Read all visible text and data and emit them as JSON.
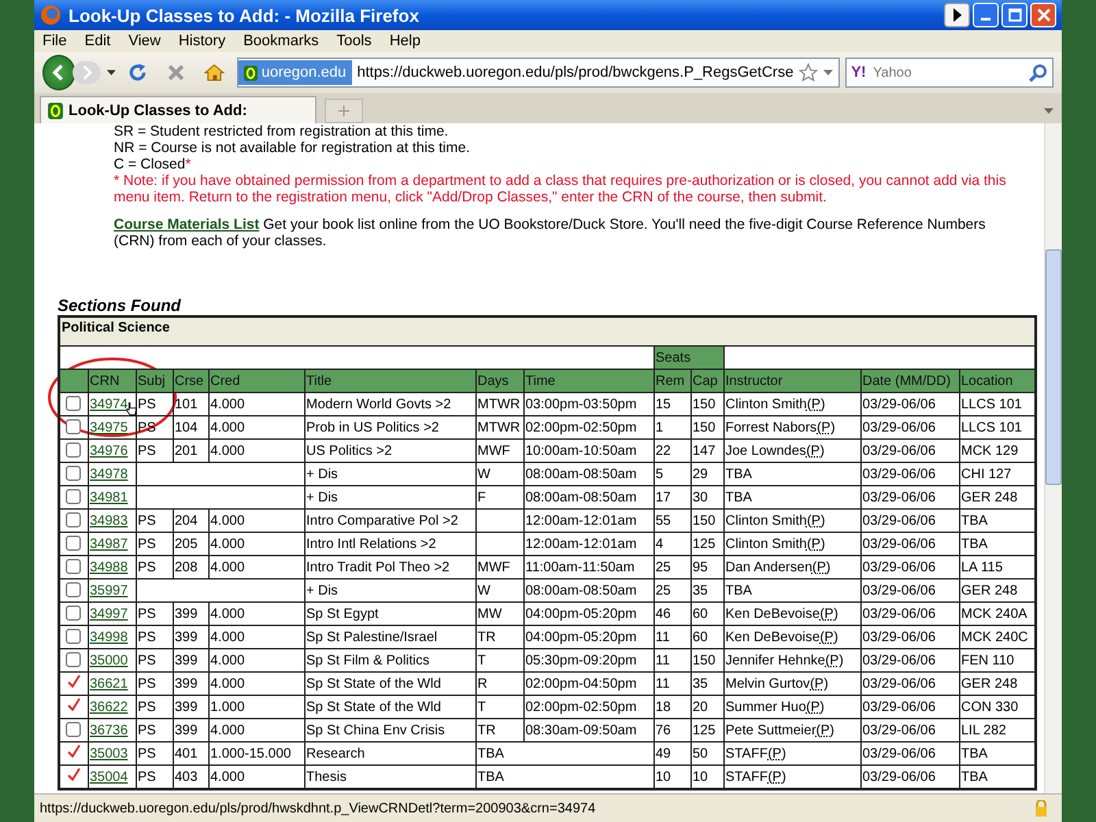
{
  "window": {
    "title": "Look-Up Classes to Add: - Mozilla Firefox"
  },
  "menu": [
    "File",
    "Edit",
    "View",
    "History",
    "Bookmarks",
    "Tools",
    "Help"
  ],
  "toolbar": {
    "site": "uoregon.edu",
    "url": "https://duckweb.uoregon.edu/pls/prod/bwckgens.P_RegsGetCrse",
    "engine_mark": "Y!",
    "search_placeholder": "Yahoo"
  },
  "tabs": [
    {
      "label": "Look-Up Classes to Add:",
      "selected": true
    }
  ],
  "legend": [
    {
      "text": "SR = Student restricted from registration at this time."
    },
    {
      "text": "NR = Course is not available for registration at this time."
    },
    {
      "text": "C = Closed",
      "marker": "*"
    }
  ],
  "note": "* Note: if you have obtained permission from a department to add a class that requires pre-authorization or is closed, you cannot add via this menu item. Return to the registration menu, click \"Add/Drop Classes,\" enter the CRN of the course, then submit.",
  "materials": {
    "link": "Course Materials List",
    "text": "Get your book list online from the UO Bookstore/Duck Store. You'll need the five-digit Course Reference Numbers (CRN) from each of your classes."
  },
  "sections": {
    "heading": "Sections Found",
    "subject": "Political Science",
    "group_header": "Seats",
    "columns": [
      "CRN",
      "Subj",
      "Crse",
      "Cred",
      "Title",
      "Days",
      "Time",
      "Rem",
      "Cap",
      "Instructor",
      "Date (MM/DD)",
      "Location"
    ],
    "rows": [
      {
        "registered": false,
        "crn": "34974",
        "subj": "PS",
        "crse": "101",
        "cred": "4.000",
        "title": "Modern World Govts >2",
        "days": "MTWR",
        "time": "03:00pm-03:50pm",
        "rem": "15",
        "cap": "150",
        "instructor": "Clinton Smith",
        "role": "(P)",
        "date": "03/29-06/06",
        "location": "LLCS 101"
      },
      {
        "registered": false,
        "crn": "34975",
        "subj": "PS",
        "crse": "104",
        "cred": "4.000",
        "title": "Prob in US Politics >2",
        "days": "MTWR",
        "time": "02:00pm-02:50pm",
        "rem": "1",
        "cap": "150",
        "instructor": "Forrest Nabors",
        "role": "(P)",
        "date": "03/29-06/06",
        "location": "LLCS 101"
      },
      {
        "registered": false,
        "crn": "34976",
        "subj": "PS",
        "crse": "201",
        "cred": "4.000",
        "title": "US Politics >2",
        "days": "MWF",
        "time": "10:00am-10:50am",
        "rem": "22",
        "cap": "147",
        "instructor": "Joe Lowndes",
        "role": "(P)",
        "date": "03/29-06/06",
        "location": "MCK 129"
      },
      {
        "registered": false,
        "crn": "34978",
        "title": "+ Dis",
        "days": "W",
        "time": "08:00am-08:50am",
        "rem": "5",
        "cap": "29",
        "instructor": "TBA",
        "date": "03/29-06/06",
        "location": "CHI 127"
      },
      {
        "registered": false,
        "crn": "34981",
        "title": "+ Dis",
        "days": "F",
        "time": "08:00am-08:50am",
        "rem": "17",
        "cap": "30",
        "instructor": "TBA",
        "date": "03/29-06/06",
        "location": "GER 248"
      },
      {
        "registered": false,
        "crn": "34983",
        "subj": "PS",
        "crse": "204",
        "cred": "4.000",
        "title": "Intro Comparative Pol >2",
        "time": "12:00am-12:01am",
        "rem": "55",
        "cap": "150",
        "instructor": "Clinton Smith",
        "role": "(P)",
        "date": "03/29-06/06",
        "location": "TBA"
      },
      {
        "registered": false,
        "crn": "34987",
        "subj": "PS",
        "crse": "205",
        "cred": "4.000",
        "title": "Intro Intl Relations >2",
        "time": "12:00am-12:01am",
        "rem": "4",
        "cap": "125",
        "instructor": "Clinton Smith",
        "role": "(P)",
        "date": "03/29-06/06",
        "location": "TBA"
      },
      {
        "registered": false,
        "crn": "34988",
        "subj": "PS",
        "crse": "208",
        "cred": "4.000",
        "title": "Intro Tradit Pol Theo >2",
        "days": "MWF",
        "time": "11:00am-11:50am",
        "rem": "25",
        "cap": "95",
        "instructor": "Dan Andersen",
        "role": "(P)",
        "date": "03/29-06/06",
        "location": "LA 115"
      },
      {
        "registered": false,
        "crn": "35997",
        "title": "+ Dis",
        "days": "W",
        "time": "08:00am-08:50am",
        "rem": "25",
        "cap": "35",
        "instructor": "TBA",
        "date": "03/29-06/06",
        "location": "GER 248"
      },
      {
        "registered": false,
        "crn": "34997",
        "subj": "PS",
        "crse": "399",
        "cred": "4.000",
        "title": "Sp St Egypt",
        "days": "MW",
        "time": "04:00pm-05:20pm",
        "rem": "46",
        "cap": "60",
        "instructor": "Ken DeBevoise",
        "role": "(P)",
        "date": "03/29-06/06",
        "location": "MCK 240A"
      },
      {
        "registered": false,
        "crn": "34998",
        "subj": "PS",
        "crse": "399",
        "cred": "4.000",
        "title": "Sp St Palestine/Israel",
        "days": "TR",
        "time": "04:00pm-05:20pm",
        "rem": "11",
        "cap": "60",
        "instructor": "Ken DeBevoise",
        "role": "(P)",
        "date": "03/29-06/06",
        "location": "MCK 240C"
      },
      {
        "registered": false,
        "crn": "35000",
        "subj": "PS",
        "crse": "399",
        "cred": "4.000",
        "title": "Sp St Film & Politics",
        "days": "T",
        "time": "05:30pm-09:20pm",
        "rem": "11",
        "cap": "150",
        "instructor": "Jennifer Hehnke",
        "role": "(P)",
        "date": "03/29-06/06",
        "location": "FEN 110"
      },
      {
        "registered": true,
        "crn": "36621",
        "subj": "PS",
        "crse": "399",
        "cred": "4.000",
        "title": "Sp St State of the Wld",
        "days": "R",
        "time": "02:00pm-04:50pm",
        "rem": "11",
        "cap": "35",
        "instructor": "Melvin Gurtov",
        "role": "(P)",
        "date": "03/29-06/06",
        "location": "GER 248"
      },
      {
        "registered": true,
        "crn": "36622",
        "subj": "PS",
        "crse": "399",
        "cred": "1.000",
        "title": "Sp St State of the Wld",
        "days": "T",
        "time": "02:00pm-02:50pm",
        "rem": "18",
        "cap": "20",
        "instructor": "Summer Huo",
        "role": "(P)",
        "date": "03/29-06/06",
        "location": "CON 330"
      },
      {
        "registered": false,
        "crn": "36736",
        "subj": "PS",
        "crse": "399",
        "cred": "4.000",
        "title": "Sp St China Env Crisis",
        "days": "TR",
        "time": "08:30am-09:50am",
        "rem": "76",
        "cap": "125",
        "instructor": "Pete Suttmeier",
        "role": "(P)",
        "date": "03/29-06/06",
        "location": "LIL 282"
      },
      {
        "registered": true,
        "crn": "35003",
        "subj": "PS",
        "crse": "401",
        "cred": "1.000-15.000",
        "title": "Research",
        "days": "TBA",
        "rem": "49",
        "cap": "50",
        "instructor": "STAFF",
        "role": "(P)",
        "date": "03/29-06/06",
        "location": "TBA"
      },
      {
        "registered": true,
        "crn": "35004",
        "subj": "PS",
        "crse": "403",
        "cred": "4.000",
        "title": "Thesis",
        "days": "TBA",
        "rem": "10",
        "cap": "10",
        "instructor": "STAFF",
        "role": "(P)",
        "date": "03/29-06/06",
        "location": "TBA"
      }
    ]
  },
  "status_bar": {
    "text": "https://duckweb.uoregon.edu/pls/prod/hwskdhnt.p_ViewCRNDetl?term=200903&crn=34974"
  }
}
